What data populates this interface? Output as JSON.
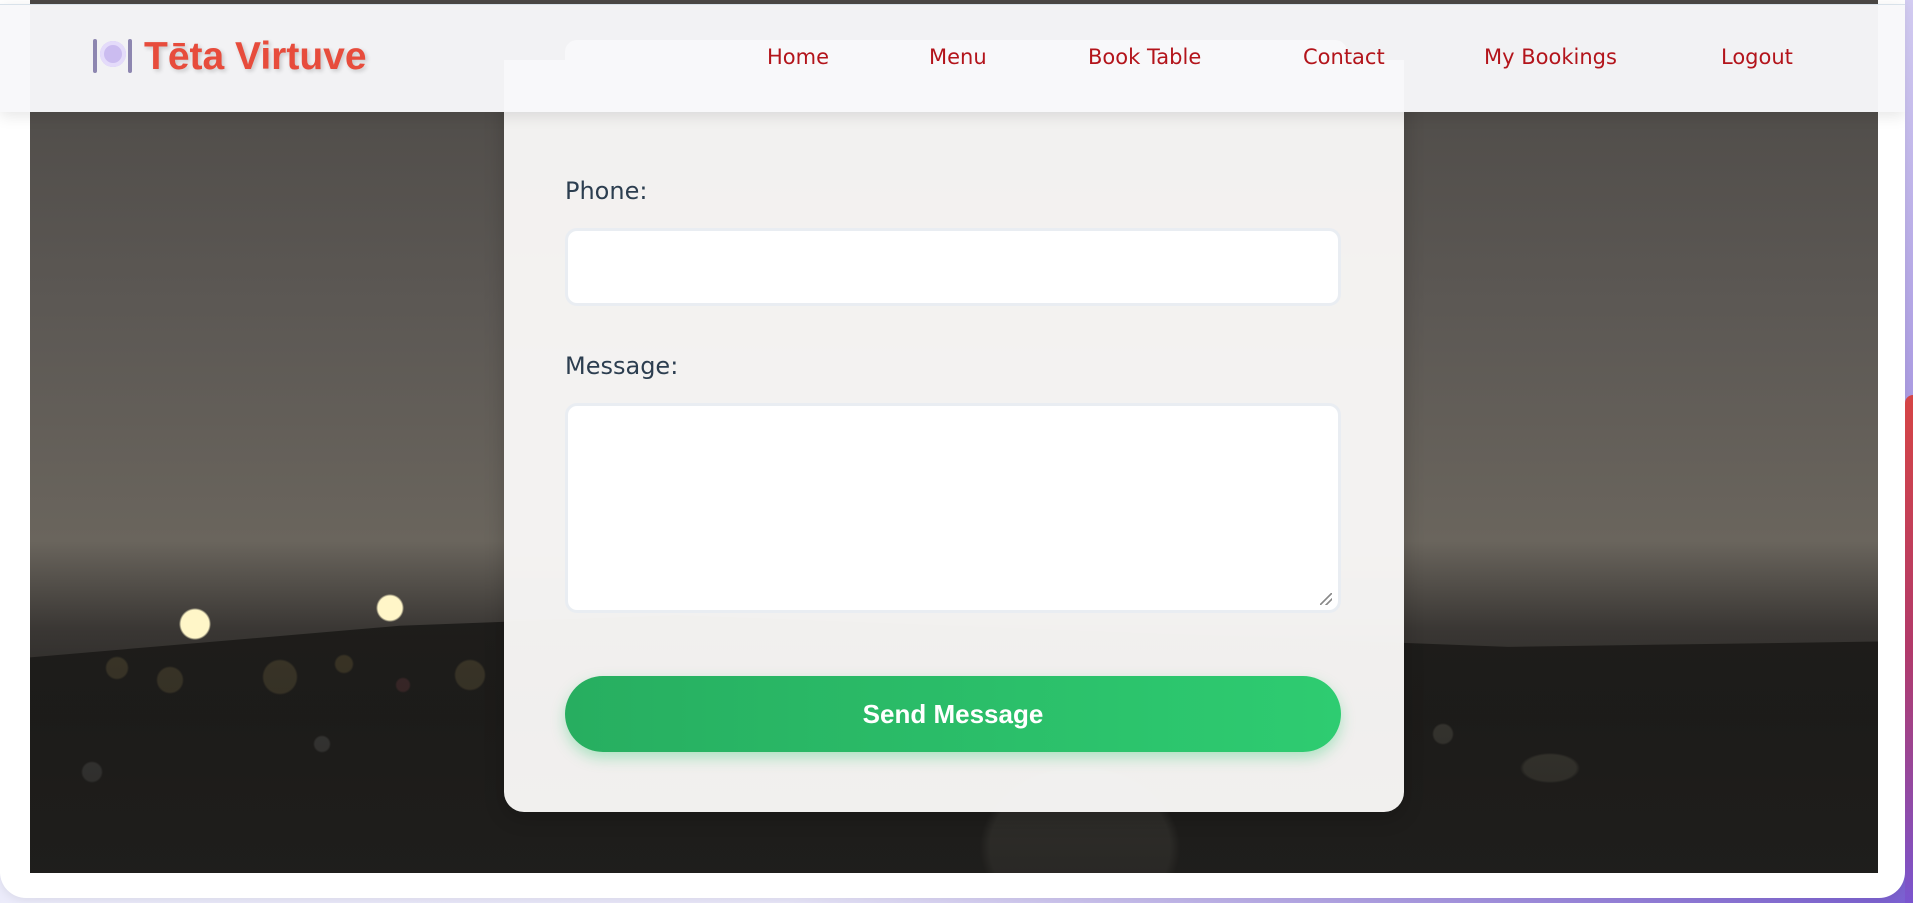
{
  "brand": {
    "name": "Tēta Virtuve",
    "icon": "plate-fork-knife-icon"
  },
  "nav": {
    "home": "Home",
    "menu": "Menu",
    "book_table": "Book Table",
    "contact": "Contact",
    "my_bookings": "My Bookings",
    "logout": "Logout"
  },
  "form": {
    "phone_label": "Phone:",
    "phone_value": "",
    "message_label": "Message:",
    "message_value": "",
    "submit_label": "Send Message"
  },
  "colors": {
    "brand": "#e74c3c",
    "nav_link": "#b3141b",
    "submit_start": "#27ae60",
    "submit_end": "#2ecc71",
    "label": "#2c3e50"
  }
}
